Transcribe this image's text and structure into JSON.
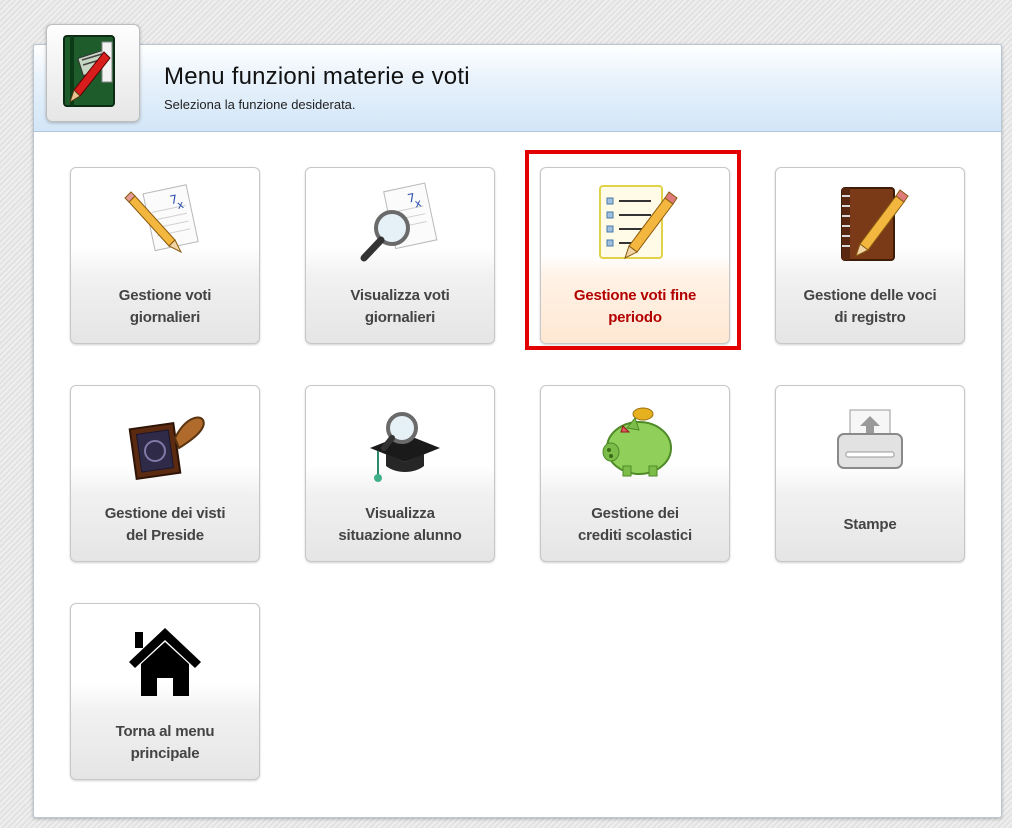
{
  "header": {
    "title": "Menu funzioni materie e voti",
    "subtitle": "Seleziona la funzione desiderata.",
    "icon": "notebook-pencil-icon"
  },
  "tiles": [
    {
      "id": "gestione-voti-giornalieri",
      "lines": [
        "Gestione voti",
        "giornalieri"
      ],
      "icon": "pencil-sheet-icon",
      "selected": false
    },
    {
      "id": "visualizza-voti-giornalieri",
      "lines": [
        "Visualizza voti",
        "giornalieri"
      ],
      "icon": "magnifier-sheet-icon",
      "selected": false
    },
    {
      "id": "gestione-voti-fine-periodo",
      "lines": [
        "Gestione voti fine",
        "periodo"
      ],
      "icon": "checklist-pencil-icon",
      "selected": true
    },
    {
      "id": "gestione-voci-registro",
      "lines": [
        "Gestione delle voci",
        "di registro"
      ],
      "icon": "register-book-icon",
      "selected": false
    },
    {
      "id": "gestione-visti-preside",
      "lines": [
        "Gestione dei visti",
        "del Preside"
      ],
      "icon": "rubber-stamp-icon",
      "selected": false
    },
    {
      "id": "visualizza-situazione-alunno",
      "lines": [
        "Visualizza",
        "situazione alunno"
      ],
      "icon": "magnifier-graduation-cap-icon",
      "selected": false
    },
    {
      "id": "gestione-crediti-scolastici",
      "lines": [
        "Gestione dei",
        "crediti scolastici"
      ],
      "icon": "piggy-bank-icon",
      "selected": false
    },
    {
      "id": "stampe",
      "lines": [
        "Stampe"
      ],
      "icon": "printer-icon",
      "selected": false
    },
    {
      "id": "torna-menu-principale",
      "lines": [
        "Torna al menu",
        "principale"
      ],
      "icon": "home-icon",
      "selected": false
    }
  ],
  "colors": {
    "highlight": "#e30000",
    "selected_label": "#b30000",
    "label": "#444444"
  }
}
